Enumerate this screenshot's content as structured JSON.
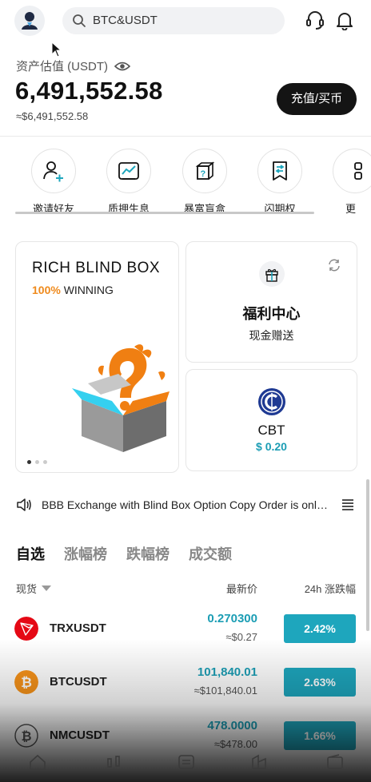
{
  "header": {
    "search_placeholder": "BTC&USDT"
  },
  "assets": {
    "label": "资产估值 (USDT)",
    "value": "6,491,552.58",
    "approx": "≈$6,491,552.58",
    "deposit_button": "充值/买币"
  },
  "quick_actions": [
    {
      "label": "邀请好友",
      "icon": "invite-icon"
    },
    {
      "label": "质押生息",
      "icon": "staking-icon"
    },
    {
      "label": "暴富盲盒",
      "icon": "blind-box-icon"
    },
    {
      "label": "闪期权",
      "icon": "flash-option-icon"
    },
    {
      "label": "更",
      "icon": "more-icon"
    }
  ],
  "banner": {
    "title": "RICH BLIND BOX",
    "sub_pct": "100%",
    "sub_text": " WINNING"
  },
  "welfare": {
    "title": "福利中心",
    "subtitle": "现金赠送"
  },
  "cbt": {
    "symbol": "CBT",
    "price": "$ 0.20"
  },
  "notice": {
    "text": "BBB Exchange with Blind Box Option Copy Order is online"
  },
  "market": {
    "tabs": [
      "自选",
      "涨幅榜",
      "跌幅榜",
      "成交额"
    ],
    "active_tab": 0,
    "col_spot": "现货",
    "col_price": "最新价",
    "col_change": "24h 涨跌幅",
    "rows": [
      {
        "symbol": "TRXUSDT",
        "price": "0.270300",
        "usd": "≈$0.27",
        "change": "2.42%",
        "icon_color": "#e50915"
      },
      {
        "symbol": "BTCUSDT",
        "price": "101,840.01",
        "usd": "≈$101,840.01",
        "change": "2.63%",
        "icon_color": "#f7931a"
      },
      {
        "symbol": "NMCUSDT",
        "price": "478.0000",
        "usd": "≈$478.00",
        "change": "1.66%",
        "icon_color": "#6b6b6b"
      }
    ]
  },
  "colors": {
    "accent": "#1ea6bd",
    "orange": "#ef8a1c",
    "dark": "#141414"
  }
}
